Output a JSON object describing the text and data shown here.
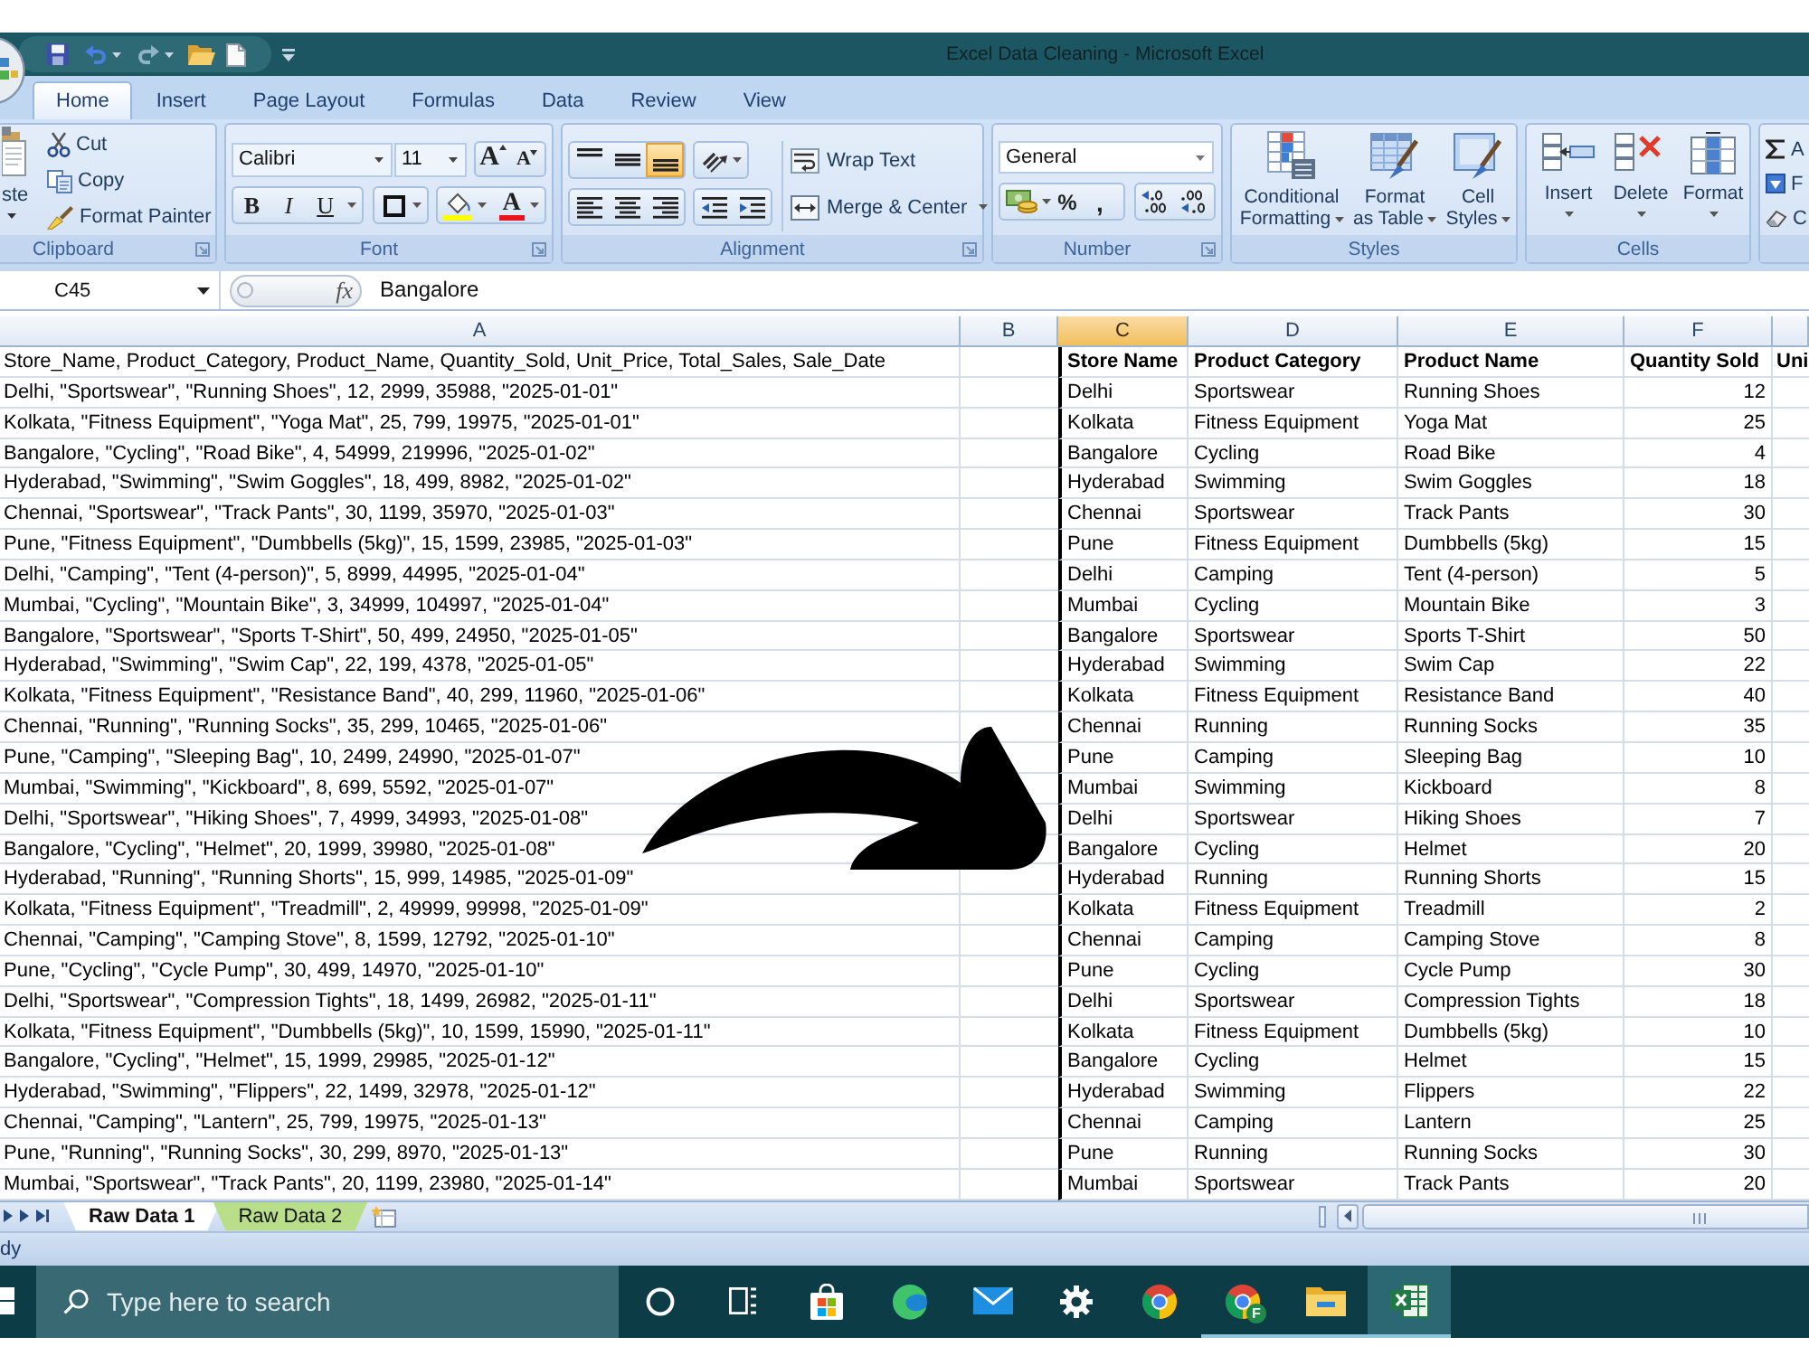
{
  "window": {
    "title": "Excel Data Cleaning - Microsoft Excel"
  },
  "tabs": [
    {
      "label": "Home",
      "selected": true
    },
    {
      "label": "Insert",
      "selected": false
    },
    {
      "label": "Page Layout",
      "selected": false
    },
    {
      "label": "Formulas",
      "selected": false
    },
    {
      "label": "Data",
      "selected": false
    },
    {
      "label": "Review",
      "selected": false
    },
    {
      "label": "View",
      "selected": false
    }
  ],
  "ribbon": {
    "clipboard": {
      "paste": "ste",
      "commands": [
        {
          "kind": "cut",
          "label": "Cut"
        },
        {
          "kind": "copy",
          "label": "Copy"
        },
        {
          "kind": "painter",
          "label": "Format Painter"
        }
      ],
      "label": "Clipboard"
    },
    "font": {
      "font_name": "Calibri",
      "font_size": "11",
      "grow": "A",
      "shrink": "A",
      "styles": [
        {
          "kind": "bold",
          "label": "B"
        },
        {
          "kind": "italic",
          "label": "I"
        },
        {
          "kind": "underline",
          "label": "U"
        }
      ],
      "font_color": "A",
      "label": "Font"
    },
    "alignment": {
      "vertical_align": [
        {
          "kind": "top",
          "selected": false
        },
        {
          "kind": "middle",
          "selected": false
        },
        {
          "kind": "bottom",
          "selected": true
        }
      ],
      "wrap_text": "Wrap Text",
      "merge": "Merge & Center",
      "label": "Alignment"
    },
    "number": {
      "format": "General",
      "percent": "%",
      "comma": ",",
      "label": "Number"
    },
    "styles": {
      "buttons": [
        {
          "kind": "conditional",
          "lines": [
            "Conditional",
            "Formatting"
          ]
        },
        {
          "kind": "table",
          "lines": [
            "Format",
            "as Table"
          ]
        },
        {
          "kind": "cell",
          "lines": [
            "Cell",
            "Styles"
          ]
        }
      ],
      "label": "Styles"
    },
    "cells": {
      "buttons": [
        {
          "kind": "insert",
          "label": "Insert"
        },
        {
          "kind": "delete",
          "label": "Delete"
        },
        {
          "kind": "format",
          "label": "Format"
        }
      ],
      "label": "Cells"
    },
    "editing": {
      "items": [
        {
          "kind": "sum",
          "label": "A"
        },
        {
          "kind": "fill",
          "label": "F"
        },
        {
          "kind": "clear",
          "label": "C"
        }
      ]
    }
  },
  "formula_bar": {
    "name_box": "C45",
    "function_label": "fx",
    "value": "Bangalore"
  },
  "sheet": {
    "columns": [
      {
        "label": "A",
        "selected": false
      },
      {
        "label": "B",
        "selected": false
      },
      {
        "label": "C",
        "selected": true
      },
      {
        "label": "D",
        "selected": false
      },
      {
        "label": "E",
        "selected": false
      },
      {
        "label": "F",
        "selected": false
      }
    ],
    "header_row": {
      "raw": "Store_Name, Product_Category, Product_Name, Quantity_Sold, Unit_Price, Total_Sales, Sale_Date",
      "store": "Store Name",
      "category": "Product Category",
      "product": "Product Name",
      "quantity": "Quantity Sold",
      "column_7": "Uni"
    },
    "rows": [
      {
        "raw": "Delhi, \"Sportswear\", \"Running Shoes\", 12, 2999, 35988, \"2025-01-01\"",
        "store": "Delhi",
        "category": "Sportswear",
        "product": "Running Shoes",
        "quantity": "12"
      },
      {
        "raw": "Kolkata, \"Fitness Equipment\", \"Yoga Mat\", 25, 799, 19975, \"2025-01-01\"",
        "store": "Kolkata",
        "category": "Fitness Equipment",
        "product": "Yoga Mat",
        "quantity": "25"
      },
      {
        "raw": "Bangalore, \"Cycling\", \"Road Bike\", 4, 54999, 219996, \"2025-01-02\"",
        "store": "Bangalore",
        "category": "Cycling",
        "product": "Road Bike",
        "quantity": "4"
      },
      {
        "raw": "Hyderabad, \"Swimming\", \"Swim Goggles\", 18, 499, 8982, \"2025-01-02\"",
        "store": "Hyderabad",
        "category": "Swimming",
        "product": "Swim Goggles",
        "quantity": "18"
      },
      {
        "raw": "Chennai, \"Sportswear\", \"Track Pants\", 30, 1199, 35970, \"2025-01-03\"",
        "store": "Chennai",
        "category": "Sportswear",
        "product": "Track Pants",
        "quantity": "30"
      },
      {
        "raw": "Pune, \"Fitness Equipment\", \"Dumbbells (5kg)\", 15, 1599, 23985, \"2025-01-03\"",
        "store": "Pune",
        "category": "Fitness Equipment",
        "product": "Dumbbells (5kg)",
        "quantity": "15"
      },
      {
        "raw": "Delhi, \"Camping\", \"Tent (4-person)\", 5, 8999, 44995, \"2025-01-04\"",
        "store": "Delhi",
        "category": "Camping",
        "product": "Tent (4-person)",
        "quantity": "5"
      },
      {
        "raw": "Mumbai, \"Cycling\", \"Mountain Bike\", 3, 34999, 104997, \"2025-01-04\"",
        "store": "Mumbai",
        "category": "Cycling",
        "product": "Mountain Bike",
        "quantity": "3"
      },
      {
        "raw": "Bangalore, \"Sportswear\", \"Sports T-Shirt\", 50, 499, 24950, \"2025-01-05\"",
        "store": "Bangalore",
        "category": "Sportswear",
        "product": "Sports T-Shirt",
        "quantity": "50"
      },
      {
        "raw": "Hyderabad, \"Swimming\", \"Swim Cap\", 22, 199, 4378, \"2025-01-05\"",
        "store": "Hyderabad",
        "category": "Swimming",
        "product": "Swim Cap",
        "quantity": "22"
      },
      {
        "raw": "Kolkata, \"Fitness Equipment\", \"Resistance Band\", 40, 299, 11960, \"2025-01-06\"",
        "store": "Kolkata",
        "category": "Fitness Equipment",
        "product": "Resistance Band",
        "quantity": "40"
      },
      {
        "raw": "Chennai, \"Running\", \"Running Socks\", 35, 299, 10465, \"2025-01-06\"",
        "store": "Chennai",
        "category": "Running",
        "product": "Running Socks",
        "quantity": "35"
      },
      {
        "raw": "Pune, \"Camping\", \"Sleeping Bag\", 10, 2499, 24990, \"2025-01-07\"",
        "store": "Pune",
        "category": "Camping",
        "product": "Sleeping Bag",
        "quantity": "10"
      },
      {
        "raw": "Mumbai, \"Swimming\", \"Kickboard\", 8, 699, 5592, \"2025-01-07\"",
        "store": "Mumbai",
        "category": "Swimming",
        "product": "Kickboard",
        "quantity": "8"
      },
      {
        "raw": "Delhi, \"Sportswear\", \"Hiking Shoes\", 7, 4999, 34993, \"2025-01-08\"",
        "store": "Delhi",
        "category": "Sportswear",
        "product": "Hiking Shoes",
        "quantity": "7"
      },
      {
        "raw": "Bangalore, \"Cycling\", \"Helmet\", 20, 1999, 39980, \"2025-01-08\"",
        "store": "Bangalore",
        "category": "Cycling",
        "product": "Helmet",
        "quantity": "20"
      },
      {
        "raw": "Hyderabad, \"Running\", \"Running Shorts\", 15, 999, 14985, \"2025-01-09\"",
        "store": "Hyderabad",
        "category": "Running",
        "product": "Running Shorts",
        "quantity": "15"
      },
      {
        "raw": "Kolkata, \"Fitness Equipment\", \"Treadmill\", 2, 49999, 99998, \"2025-01-09\"",
        "store": "Kolkata",
        "category": "Fitness Equipment",
        "product": "Treadmill",
        "quantity": "2"
      },
      {
        "raw": "Chennai, \"Camping\", \"Camping Stove\", 8, 1599, 12792, \"2025-01-10\"",
        "store": "Chennai",
        "category": "Camping",
        "product": "Camping Stove",
        "quantity": "8"
      },
      {
        "raw": "Pune, \"Cycling\", \"Cycle Pump\", 30, 499, 14970, \"2025-01-10\"",
        "store": "Pune",
        "category": "Cycling",
        "product": "Cycle Pump",
        "quantity": "30"
      },
      {
        "raw": "Delhi, \"Sportswear\", \"Compression Tights\", 18, 1499, 26982, \"2025-01-11\"",
        "store": "Delhi",
        "category": "Sportswear",
        "product": "Compression Tights",
        "quantity": "18"
      },
      {
        "raw": "Kolkata, \"Fitness Equipment\", \"Dumbbells (5kg)\", 10, 1599, 15990, \"2025-01-11\"",
        "store": "Kolkata",
        "category": "Fitness Equipment",
        "product": "Dumbbells (5kg)",
        "quantity": "10"
      },
      {
        "raw": "Bangalore, \"Cycling\", \"Helmet\", 15, 1999, 29985, \"2025-01-12\"",
        "store": "Bangalore",
        "category": "Cycling",
        "product": "Helmet",
        "quantity": "15"
      },
      {
        "raw": "Hyderabad, \"Swimming\", \"Flippers\", 22, 1499, 32978, \"2025-01-12\"",
        "store": "Hyderabad",
        "category": "Swimming",
        "product": "Flippers",
        "quantity": "22"
      },
      {
        "raw": "Chennai, \"Camping\", \"Lantern\", 25, 799, 19975, \"2025-01-13\"",
        "store": "Chennai",
        "category": "Camping",
        "product": "Lantern",
        "quantity": "25"
      },
      {
        "raw": "Pune, \"Running\", \"Running Socks\", 30, 299, 8970, \"2025-01-13\"",
        "store": "Pune",
        "category": "Running",
        "product": "Running Socks",
        "quantity": "30"
      },
      {
        "raw": "Mumbai, \"Sportswear\", \"Track Pants\", 20, 1199, 23980, \"2025-01-14\"",
        "store": "Mumbai",
        "category": "Sportswear",
        "product": "Track Pants",
        "quantity": "20"
      }
    ]
  },
  "sheet_tabs": [
    {
      "label": "Raw Data 1",
      "selected": true
    },
    {
      "label": "Raw Data 2",
      "selected": false,
      "color": "#b9de8a"
    }
  ],
  "status_bar": {
    "text": "dy"
  },
  "taskbar": {
    "search_placeholder": "Type here to search",
    "apps": [
      {
        "kind": "cortana",
        "running": false,
        "selected": false
      },
      {
        "kind": "task_view",
        "running": false,
        "selected": false
      },
      {
        "kind": "store",
        "running": false,
        "selected": false
      },
      {
        "kind": "edge",
        "running": false,
        "selected": false
      },
      {
        "kind": "mail",
        "running": false,
        "selected": false
      },
      {
        "kind": "settings",
        "running": false,
        "selected": false
      },
      {
        "kind": "chrome",
        "running": false,
        "selected": false
      },
      {
        "kind": "chrome",
        "running": true,
        "selected": false,
        "badge": "F"
      },
      {
        "kind": "explorer",
        "running": true,
        "selected": false
      },
      {
        "kind": "excel",
        "running": true,
        "selected": true
      }
    ]
  }
}
